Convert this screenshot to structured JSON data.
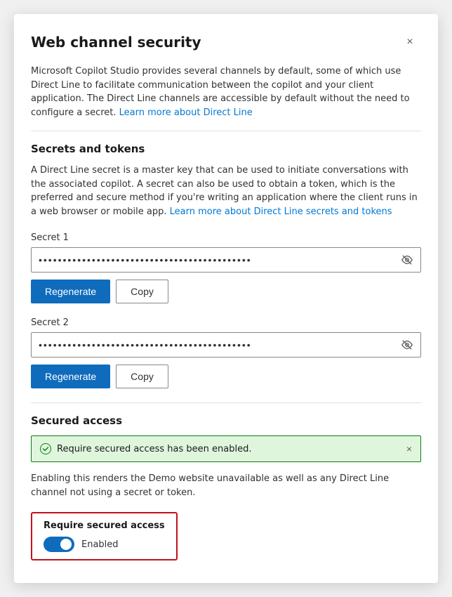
{
  "modal": {
    "title": "Web channel security",
    "close_label": "×"
  },
  "intro": {
    "text": "Microsoft Copilot Studio provides several channels by default, some of which use Direct Line to facilitate communication between the copilot and your client application. The Direct Line channels are accessible by default without the need to configure a secret.",
    "link_text": "Learn more about Direct Line",
    "link_href": "#"
  },
  "secrets_section": {
    "title": "Secrets and tokens",
    "description": "A Direct Line secret is a master key that can be used to initiate conversations with the associated copilot. A secret can also be used to obtain a token, which is the preferred and secure method if you're writing an application where the client runs in a web browser or mobile app.",
    "link_text": "Learn more about Direct Line secrets and tokens",
    "link_href": "#"
  },
  "secret1": {
    "label": "Secret 1",
    "value": "••••••••••••••••••••••••••••••••••••••••••••",
    "regenerate_label": "Regenerate",
    "copy_label": "Copy",
    "show_icon": "eye-icon"
  },
  "secret2": {
    "label": "Secret 2",
    "value": "••••••••••••••••••••••••••••••••••••••••••••",
    "regenerate_label": "Regenerate",
    "copy_label": "Copy",
    "show_icon": "eye-icon"
  },
  "secured_access": {
    "title": "Secured access",
    "banner_text": "Require secured access has been enabled.",
    "description": "Enabling this renders the Demo website unavailable as well as any Direct Line channel not using a secret or token.",
    "toggle_label": "Require secured access",
    "toggle_status": "Enabled",
    "toggle_enabled": true
  }
}
